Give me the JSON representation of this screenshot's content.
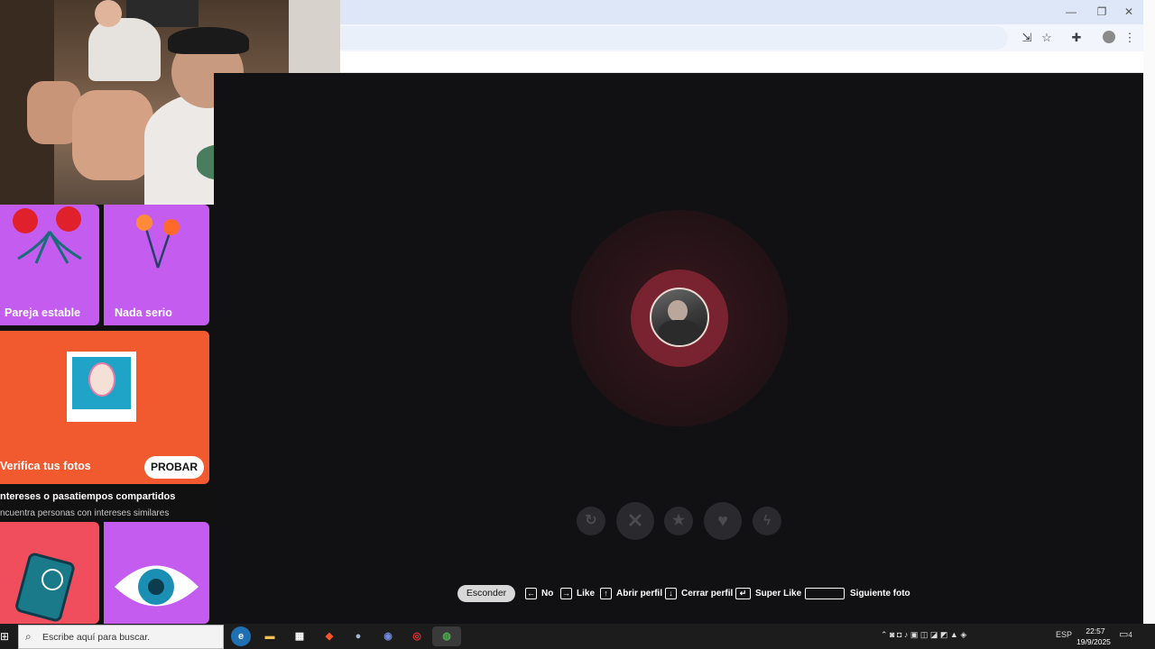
{
  "browser": {
    "window_controls": {
      "minimize": "—",
      "restore": "❐",
      "close": "✕"
    },
    "toolbar_icons": [
      "install-app-icon",
      "bookmark-star-icon",
      "extensions-icon",
      "profile-avatar-icon",
      "more-menu-icon"
    ]
  },
  "left_panel": {
    "cards": {
      "pareja": {
        "label": "Pareja estable",
        "color": "#c45cf0"
      },
      "nada": {
        "label": "Nada serio",
        "color": "#c45cf0"
      },
      "verify": {
        "label": "Verifica tus fotos",
        "button": "PROBAR",
        "color": "#f05a2e"
      }
    },
    "section": {
      "title": "ntereses o pasatiempos compartidos",
      "subtitle": "ncuentra personas con intereses similares"
    },
    "bottom_cards": {
      "left_color": "#f04e5c",
      "right_color": "#c45cf0"
    }
  },
  "main": {
    "actions": [
      "rewind-icon",
      "nope-icon",
      "super-like-icon",
      "like-icon",
      "boost-icon"
    ],
    "shortcuts": {
      "esconder": "Esconder",
      "no": "No",
      "like": "Like",
      "abrir": "Abrir perfil",
      "cerrar": "Cerrar perfil",
      "super": "Super Like",
      "siguiente": "Siguiente foto"
    }
  },
  "taskbar": {
    "search_placeholder": "Escribe aquí para buscar.",
    "language": "ESP",
    "time": "22:57",
    "date": "19/9/2025",
    "notification_count": "4"
  }
}
